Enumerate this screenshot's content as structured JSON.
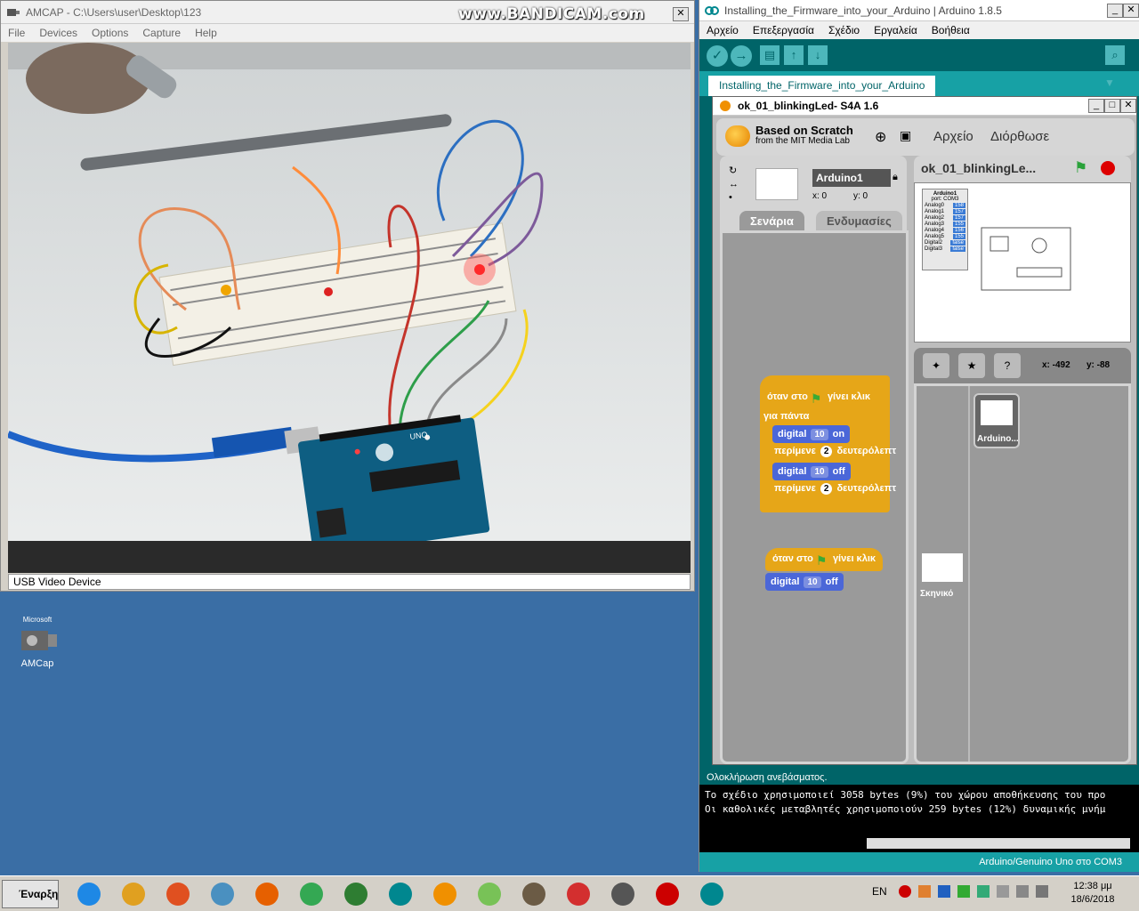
{
  "amcap": {
    "title": "AMCAP - C:\\Users\\user\\Desktop\\123",
    "menu": [
      "File",
      "Devices",
      "Options",
      "Capture",
      "Help"
    ],
    "status": "USB Video Device",
    "watermark": "www.BANDICAM.com",
    "board_label": "UNO"
  },
  "arduino": {
    "title": "Installing_the_Firmware_into_your_Arduino | Arduino 1.8.5",
    "menu": [
      "Αρχείο",
      "Επεξεργασία",
      "Σχέδιο",
      "Εργαλεία",
      "Βοήθεια"
    ],
    "tab": "Installing_the_Firmware_into_your_Arduino",
    "console_top": "Ολοκλήρωση ανεβάσματος.",
    "console_lines": [
      "Το σχέδιο χρησιμοποιεί 3058 bytes (9%) του χώρου αποθήκευσης του προ",
      "Οι καθολικές μεταβλητές χρησιμοποιούν 259 bytes (12%) δυναμικής μνήμ"
    ],
    "status": "Arduino/Genuino Uno στο COM3"
  },
  "s4a": {
    "title": "ok_01_blinkingLed- S4A 1.6",
    "based": "Based on Scratch",
    "mit": "from the MIT Media Lab",
    "menu_file": "Αρχείο",
    "menu_edit": "Διόρθωσε",
    "sprite_name": "Arduino1",
    "x_label": "x: 0",
    "y_label": "y: 0",
    "tab_scripts": "Σενάρια",
    "tab_costumes": "Ενδυμασίες",
    "project_name": "ok_01_blinkingLe...",
    "mouse_x": "x: -492",
    "mouse_y": "y: -88",
    "sprite_thumb": "Arduino...",
    "stage_label": "Σκηνικό",
    "stage_board_title": "Arduino1",
    "stage_board_port": "port: COM3",
    "stage_sensors": [
      {
        "name": "Analog0",
        "value": "158"
      },
      {
        "name": "Analog1",
        "value": "157"
      },
      {
        "name": "Analog2",
        "value": "157"
      },
      {
        "name": "Analog3",
        "value": "155"
      },
      {
        "name": "Analog4",
        "value": "156"
      },
      {
        "name": "Analog5",
        "value": "155"
      },
      {
        "name": "Digital2",
        "value": "false"
      },
      {
        "name": "Digital3",
        "value": "false"
      }
    ],
    "script1": {
      "hat_pre": "όταν στο",
      "hat_post": "γίνει κλικ",
      "forever": "για πάντα",
      "d1": "digital",
      "d1_pin": "10",
      "d1_state": "on",
      "wait1": "περίμενε",
      "wait1_val": "2",
      "wait1_unit": "δευτερόλεπτ",
      "d2": "digital",
      "d2_pin": "10",
      "d2_state": "off",
      "wait2": "περίμενε",
      "wait2_val": "2",
      "wait2_unit": "δευτερόλεπτ"
    },
    "script2": {
      "hat_pre": "όταν στο",
      "hat_post": "γίνει κλικ",
      "d": "digital",
      "d_pin": "10",
      "d_state": "off"
    }
  },
  "desktop": {
    "icon_top": "Microsoft",
    "icon_label": "AMCap"
  },
  "taskbar": {
    "start": "Έναρξη",
    "lang": "EN",
    "time": "12:38 μμ",
    "date": "18/6/2018",
    "apps": [
      "ie-icon",
      "explorer-icon",
      "media-player-icon",
      "control-panel-icon",
      "firefox-icon",
      "chrome-icon",
      "tree-app-icon",
      "arduino-icon",
      "s4a-icon",
      "android-icon",
      "gimp-icon",
      "arrow-app-icon",
      "amcap-icon",
      "bandicam-icon",
      "arduino-icon-2"
    ]
  },
  "colors": {
    "desktop": "#3a6ea5",
    "arduino_teal": "#006468",
    "arduino_light": "#4db7bb",
    "scratch_hat": "#e6a618",
    "scratch_blue": "#4b67d8"
  }
}
